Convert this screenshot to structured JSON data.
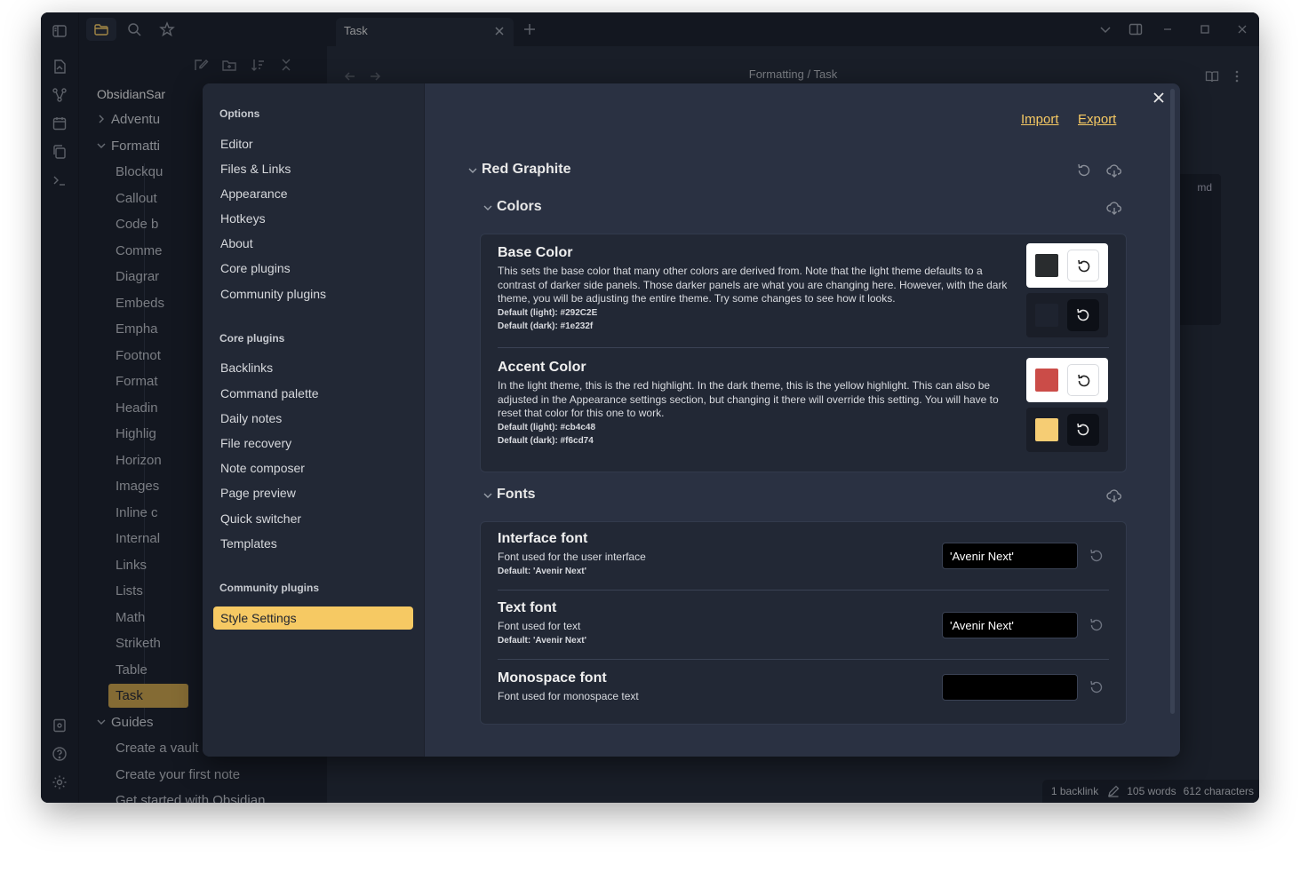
{
  "window": {
    "tab_title": "Task",
    "breadcrumb": "Formatting / Task",
    "md_label": "md"
  },
  "file_explorer": {
    "vault_name": "ObsidianSar",
    "tree": [
      {
        "label": "Adventu",
        "kind": "folder",
        "expanded": false
      },
      {
        "label": "Formatti",
        "kind": "folder",
        "expanded": true
      },
      {
        "label": "Blockqu",
        "kind": "file"
      },
      {
        "label": "Callout",
        "kind": "file"
      },
      {
        "label": "Code b",
        "kind": "file"
      },
      {
        "label": "Comme",
        "kind": "file"
      },
      {
        "label": "Diagrar",
        "kind": "file"
      },
      {
        "label": "Embeds",
        "kind": "file"
      },
      {
        "label": "Empha",
        "kind": "file"
      },
      {
        "label": "Footnot",
        "kind": "file"
      },
      {
        "label": "Format",
        "kind": "file"
      },
      {
        "label": "Headin",
        "kind": "file"
      },
      {
        "label": "Highlig",
        "kind": "file"
      },
      {
        "label": "Horizon",
        "kind": "file"
      },
      {
        "label": "Images",
        "kind": "file"
      },
      {
        "label": "Inline c",
        "kind": "file"
      },
      {
        "label": "Internal",
        "kind": "file"
      },
      {
        "label": "Links",
        "kind": "file"
      },
      {
        "label": "Lists",
        "kind": "file"
      },
      {
        "label": "Math",
        "kind": "file"
      },
      {
        "label": "Striketh",
        "kind": "file"
      },
      {
        "label": "Table",
        "kind": "file"
      },
      {
        "label": "Task",
        "kind": "file",
        "active": true
      },
      {
        "label": "Guides",
        "kind": "folder",
        "expanded": true
      },
      {
        "label": "Create a vault",
        "kind": "file"
      },
      {
        "label": "Create your first note",
        "kind": "file"
      },
      {
        "label": "Get started with Obsidian",
        "kind": "file"
      }
    ]
  },
  "status": {
    "backlinks": "1 backlink",
    "words": "105 words",
    "characters": "612 characters"
  },
  "settings": {
    "nav_sections": [
      {
        "heading": "Options",
        "items": [
          "Editor",
          "Files & Links",
          "Appearance",
          "Hotkeys",
          "About",
          "Core plugins",
          "Community plugins"
        ]
      },
      {
        "heading": "Core plugins",
        "items": [
          "Backlinks",
          "Command palette",
          "Daily notes",
          "File recovery",
          "Note composer",
          "Page preview",
          "Quick switcher",
          "Templates"
        ]
      },
      {
        "heading": "Community plugins",
        "items": [
          "Style Settings"
        ]
      }
    ],
    "active_item": "Style Settings",
    "import_label": "Import",
    "export_label": "Export",
    "theme_heading": "Red Graphite",
    "colors_heading": "Colors",
    "fonts_heading": "Fonts",
    "color_settings": [
      {
        "title": "Base Color",
        "description": "This sets the base color that many other colors are derived from. Note that the light theme defaults to a contrast of darker side panels. Those darker panels are what you are changing here. However, with the dark theme, you will be adjusting the entire theme. Try some changes to see how it looks.",
        "default_light": "Default (light): #292C2E",
        "default_dark": "Default (dark): #1e232f",
        "light_value": "#292C2E",
        "dark_value": "#1e232f"
      },
      {
        "title": "Accent Color",
        "description": "In the light theme, this is the red highlight. In the dark theme, this is the yellow highlight. This can also be adjusted in the Appearance settings section, but changing it there will override this setting. You will have to reset that color for this one to work.",
        "default_light": "Default (light): #cb4c48",
        "default_dark": "Default (dark): #f6cd74",
        "light_value": "#cb4c48",
        "dark_value": "#f6cd74"
      }
    ],
    "font_settings": [
      {
        "title": "Interface font",
        "description": "Font used for the user interface",
        "default": "Default: 'Avenir Next'",
        "value": "'Avenir Next'"
      },
      {
        "title": "Text font",
        "description": "Font used for text",
        "default": "Default: 'Avenir Next'",
        "value": "'Avenir Next'"
      },
      {
        "title": "Monospace font",
        "description": "Font used for monospace text",
        "default": "",
        "value": ""
      }
    ]
  },
  "colors": {
    "accent": "#f6c963",
    "background": "#1e232f",
    "modal": "#2a3142"
  }
}
